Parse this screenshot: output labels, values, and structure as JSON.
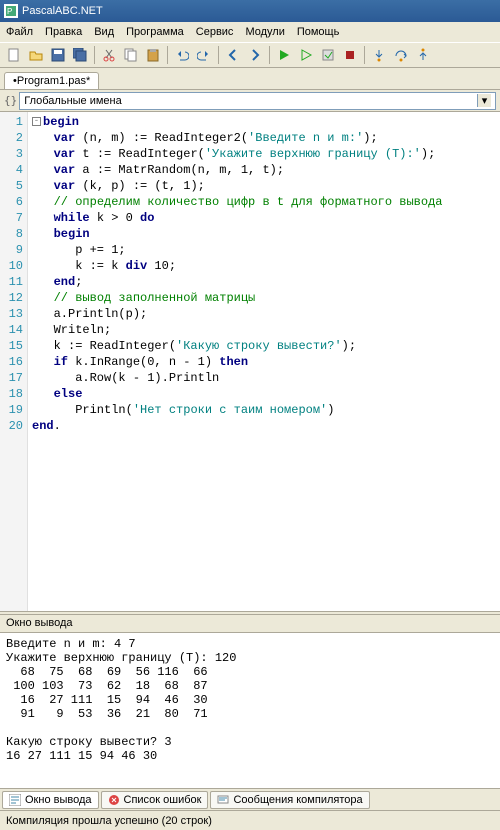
{
  "title": "PascalABC.NET",
  "menu": [
    "Файл",
    "Правка",
    "Вид",
    "Программа",
    "Сервис",
    "Модули",
    "Помощь"
  ],
  "tab": "•Program1.pas*",
  "scope_icon": "{}",
  "scope": "Глобальные имена",
  "gutter": [
    "1",
    "2",
    "3",
    "4",
    "5",
    "6",
    "7",
    "8",
    "9",
    "10",
    "11",
    "12",
    "13",
    "14",
    "15",
    "16",
    "17",
    "18",
    "19",
    "20"
  ],
  "code": {
    "l1a": "begin",
    "l2a": "   ",
    "l2b": "var",
    "l2c": " (n, m) := ReadInteger2(",
    "l2d": "'Введите n и m:'",
    "l2e": ");",
    "l3a": "   ",
    "l3b": "var",
    "l3c": " t := ReadInteger(",
    "l3d": "'Укажите верхнюю границу (T):'",
    "l3e": ");",
    "l4a": "   ",
    "l4b": "var",
    "l4c": " a := MatrRandom(n, m, 1, t);",
    "l5a": "   ",
    "l5b": "var",
    "l5c": " (k, p) := (t, 1);",
    "l6a": "   ",
    "l6b": "// определим количество цифр в t для форматного вывода",
    "l7a": "   ",
    "l7b": "while",
    "l7c": " k > 0 ",
    "l7d": "do",
    "l8a": "   ",
    "l8b": "begin",
    "l9a": "      p += 1;",
    "l10a": "      k := k ",
    "l10b": "div",
    "l10c": " 10;",
    "l11a": "   ",
    "l11b": "end",
    "l11c": ";",
    "l12a": "   ",
    "l12b": "// вывод заполненной матрицы",
    "l13a": "   a.Println(p);",
    "l14a": "   Writeln;",
    "l15a": "   k := ReadInteger(",
    "l15b": "'Какую строку вывести?'",
    "l15c": ");",
    "l16a": "   ",
    "l16b": "if",
    "l16c": " k.InRange(0, n - 1) ",
    "l16d": "then",
    "l17a": "      a.Row(k - 1).Println",
    "l18a": "   ",
    "l18b": "else",
    "l19a": "      Println(",
    "l19b": "'Нет строки с таим номером'",
    "l19c": ")",
    "l20a": "end",
    "l20b": "."
  },
  "outpanel_title": "Окно вывода",
  "output": "Введите n и m: 4 7\nУкажите верхнюю границу (T): 120\n  68  75  68  69  56 116  66\n 100 103  73  62  18  68  87\n  16  27 111  15  94  46  30\n  91   9  53  36  21  80  71\n\nКакую строку вывести? 3\n16 27 111 15 94 46 30\n",
  "bottabs": {
    "t1": "Окно вывода",
    "t2": "Список ошибок",
    "t3": "Сообщения компилятора"
  },
  "status": "Компиляция прошла успешно (20 строк)"
}
